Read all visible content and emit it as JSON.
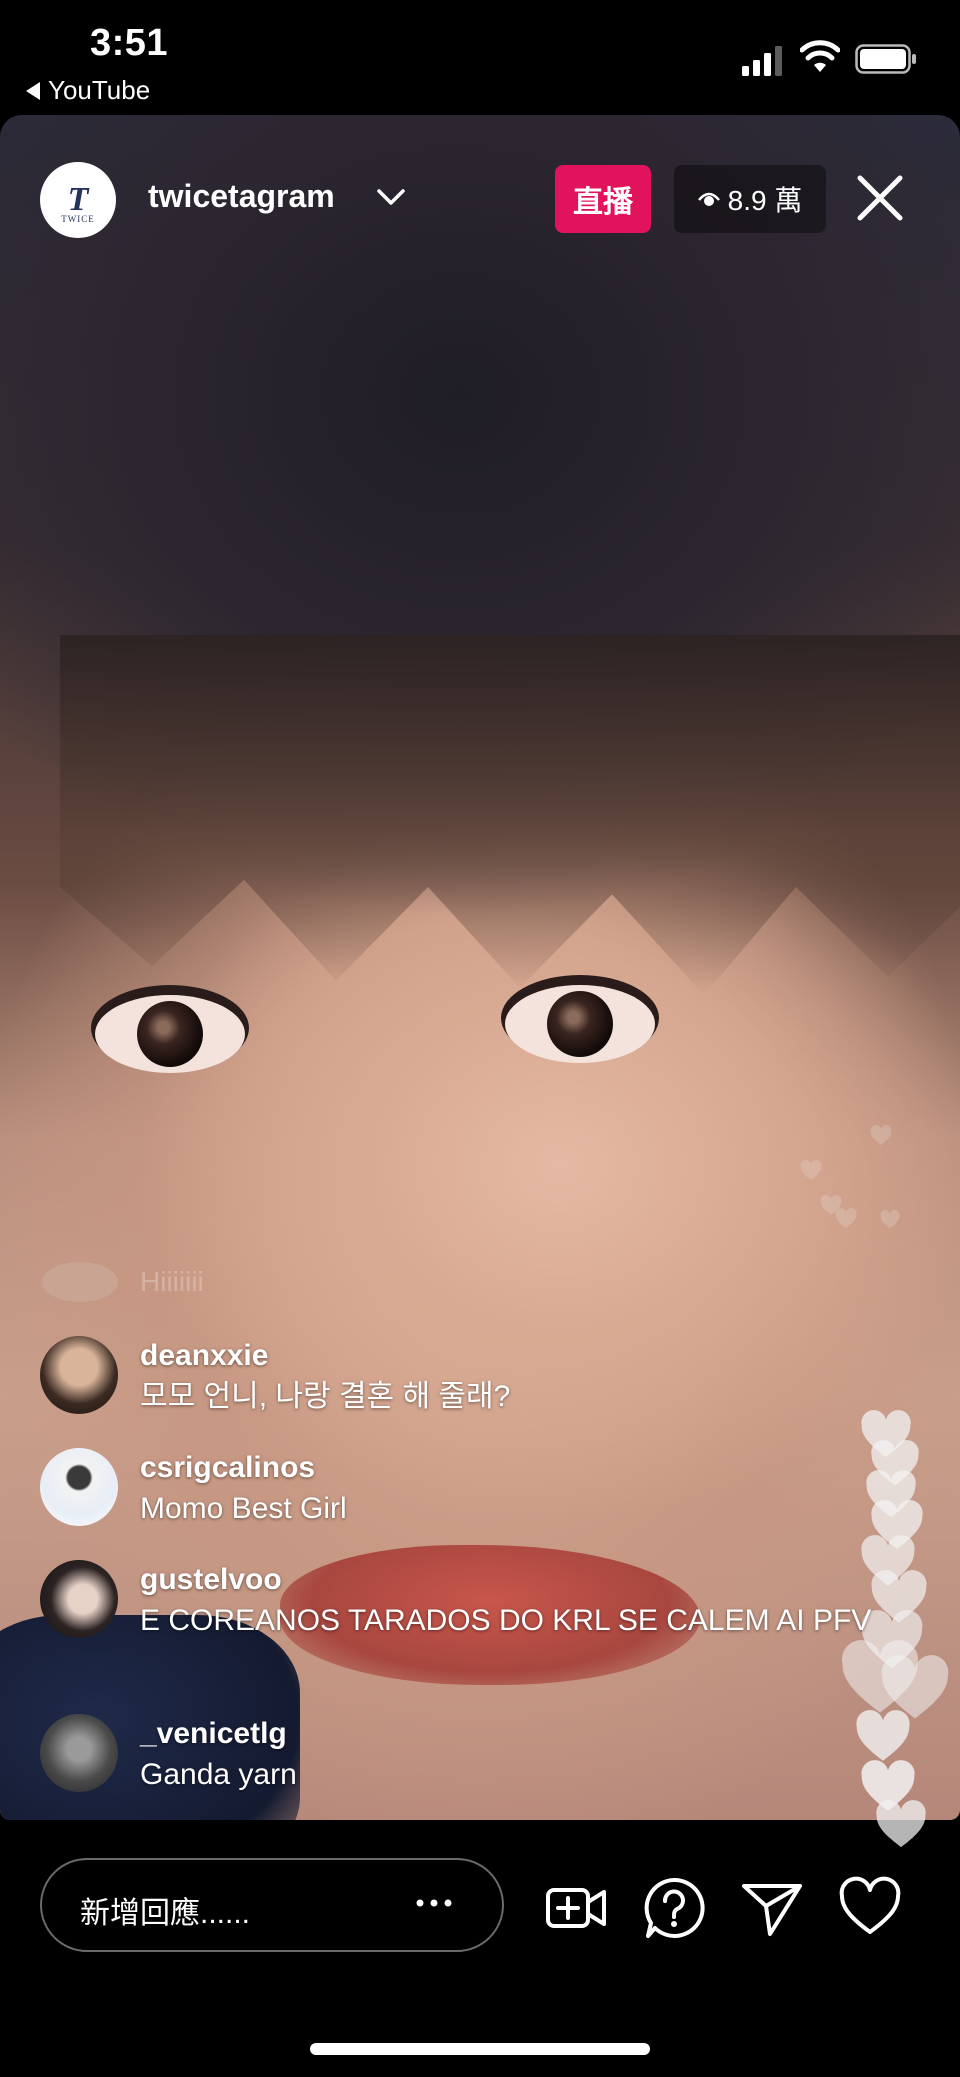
{
  "status_bar": {
    "time": "3:51",
    "back_app": "YouTube",
    "icons": [
      "cellular-signal-icon",
      "wifi-icon",
      "battery-icon"
    ]
  },
  "live": {
    "username": "twicetagram",
    "avatar_logo_text": "TWICE",
    "live_badge": "直播",
    "viewer_count": "8.9 萬",
    "badge_color": "#e0135c"
  },
  "comments": {
    "faded": {
      "text": "Hiiiiiii"
    },
    "items": [
      {
        "user": "deanxxie",
        "text": "모모 언니, 나랑 결혼 해 줄래?"
      },
      {
        "user": "csrigcalinos",
        "text": "Momo Best Girl"
      },
      {
        "user": "gustelvoo",
        "text": "E COREANOS TARADOS DO KRL SE CALEM AI PFV"
      },
      {
        "user": "_venicetlg",
        "text": "Ganda yarn"
      }
    ]
  },
  "bottom_bar": {
    "reply_placeholder": "新增回應......",
    "icons": [
      "more-options-icon",
      "add-video-icon",
      "question-icon",
      "send-icon",
      "like-heart-icon"
    ]
  }
}
